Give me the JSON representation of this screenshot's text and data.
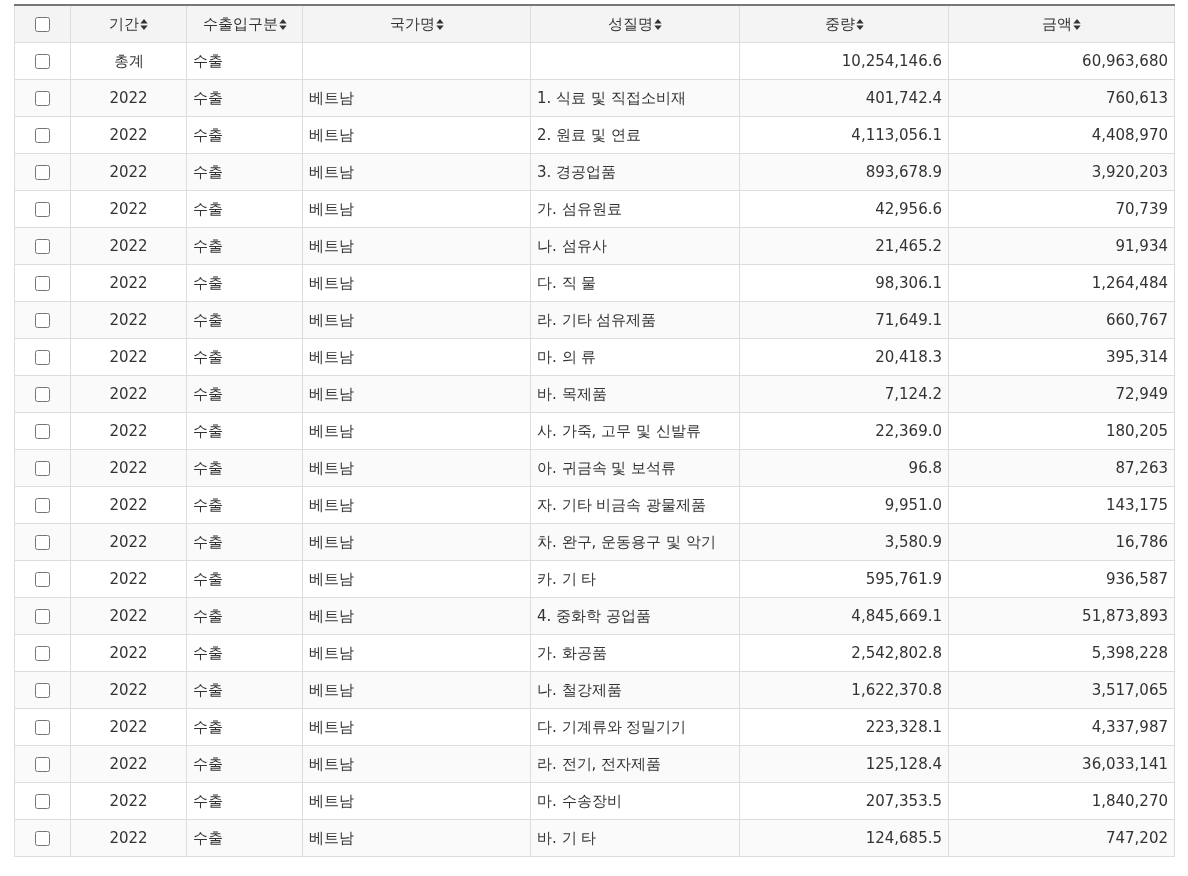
{
  "table": {
    "select_all": {
      "checked": false
    },
    "columns": [
      {
        "label": "기간"
      },
      {
        "label": "수출입구분"
      },
      {
        "label": "국가명"
      },
      {
        "label": "성질명"
      },
      {
        "label": "중량"
      },
      {
        "label": "금액"
      }
    ],
    "rows": [
      {
        "checked": false,
        "cells": [
          "총계",
          "수출",
          null,
          null,
          "10,254,146.6",
          "60,963,680"
        ]
      },
      {
        "checked": false,
        "cells": [
          "2022",
          "수출",
          "베트남",
          "1. 식료 및 직접소비재",
          "401,742.4",
          "760,613"
        ]
      },
      {
        "checked": false,
        "cells": [
          "2022",
          "수출",
          "베트남",
          "2. 원료 및 연료",
          "4,113,056.1",
          "4,408,970"
        ]
      },
      {
        "checked": false,
        "cells": [
          "2022",
          "수출",
          "베트남",
          "3. 경공업품",
          "893,678.9",
          "3,920,203"
        ]
      },
      {
        "checked": false,
        "cells": [
          "2022",
          "수출",
          "베트남",
          "가. 섬유원료",
          "42,956.6",
          "70,739"
        ]
      },
      {
        "checked": false,
        "cells": [
          "2022",
          "수출",
          "베트남",
          "나. 섬유사",
          "21,465.2",
          "91,934"
        ]
      },
      {
        "checked": false,
        "cells": [
          "2022",
          "수출",
          "베트남",
          "다. 직 물",
          "98,306.1",
          "1,264,484"
        ]
      },
      {
        "checked": false,
        "cells": [
          "2022",
          "수출",
          "베트남",
          "라. 기타 섬유제품",
          "71,649.1",
          "660,767"
        ]
      },
      {
        "checked": false,
        "cells": [
          "2022",
          "수출",
          "베트남",
          "마. 의 류",
          "20,418.3",
          "395,314"
        ]
      },
      {
        "checked": false,
        "cells": [
          "2022",
          "수출",
          "베트남",
          "바. 목제품",
          "7,124.2",
          "72,949"
        ]
      },
      {
        "checked": false,
        "cells": [
          "2022",
          "수출",
          "베트남",
          "사. 가죽, 고무 및 신발류",
          "22,369.0",
          "180,205"
        ]
      },
      {
        "checked": false,
        "cells": [
          "2022",
          "수출",
          "베트남",
          "아. 귀금속 및 보석류",
          "96.8",
          "87,263"
        ]
      },
      {
        "checked": false,
        "cells": [
          "2022",
          "수출",
          "베트남",
          "자. 기타 비금속 광물제품",
          "9,951.0",
          "143,175"
        ]
      },
      {
        "checked": false,
        "cells": [
          "2022",
          "수출",
          "베트남",
          "차. 완구, 운동용구 및 악기",
          "3,580.9",
          "16,786"
        ]
      },
      {
        "checked": false,
        "cells": [
          "2022",
          "수출",
          "베트남",
          "카. 기 타",
          "595,761.9",
          "936,587"
        ]
      },
      {
        "checked": false,
        "cells": [
          "2022",
          "수출",
          "베트남",
          "4. 중화학 공업품",
          "4,845,669.1",
          "51,873,893"
        ]
      },
      {
        "checked": false,
        "cells": [
          "2022",
          "수출",
          "베트남",
          "가. 화공품",
          "2,542,802.8",
          "5,398,228"
        ]
      },
      {
        "checked": false,
        "cells": [
          "2022",
          "수출",
          "베트남",
          "나. 철강제품",
          "1,622,370.8",
          "3,517,065"
        ]
      },
      {
        "checked": false,
        "cells": [
          "2022",
          "수출",
          "베트남",
          "다. 기계류와 정밀기기",
          "223,328.1",
          "4,337,987"
        ]
      },
      {
        "checked": false,
        "cells": [
          "2022",
          "수출",
          "베트남",
          "라. 전기, 전자제품",
          "125,128.4",
          "36,033,141"
        ]
      },
      {
        "checked": false,
        "cells": [
          "2022",
          "수출",
          "베트남",
          "마. 수송장비",
          "207,353.5",
          "1,840,270"
        ]
      },
      {
        "checked": false,
        "cells": [
          "2022",
          "수출",
          "베트남",
          "바. 기 타",
          "124,685.5",
          "747,202"
        ]
      }
    ]
  }
}
